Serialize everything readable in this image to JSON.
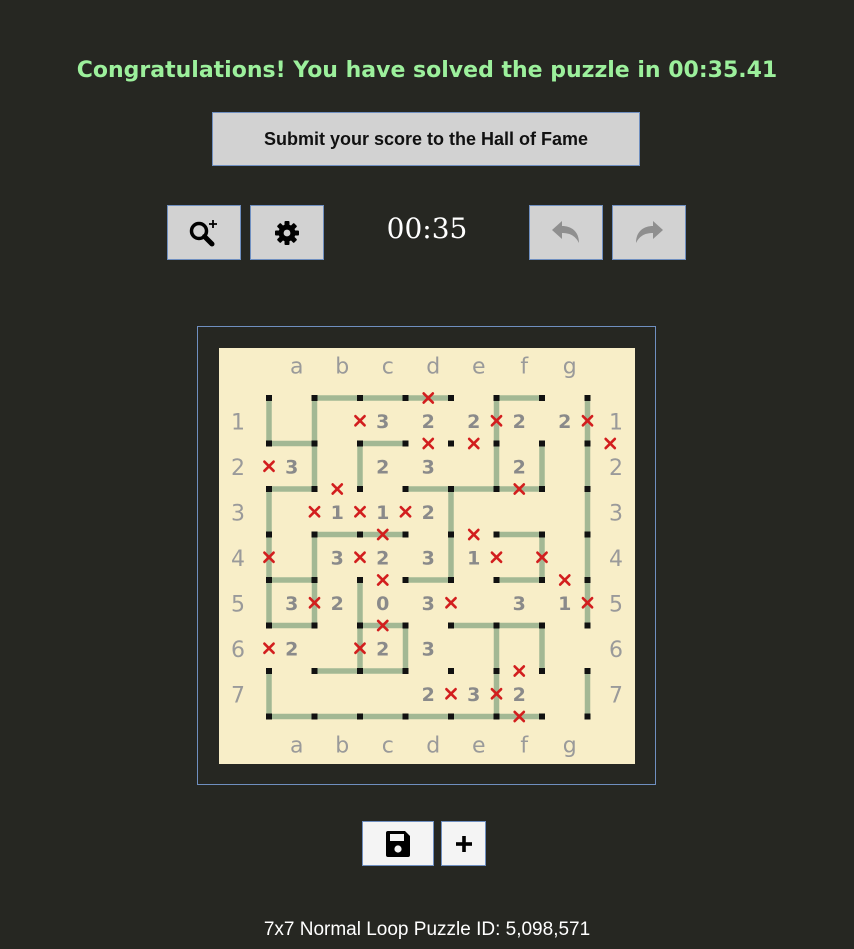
{
  "header": {
    "congrats": "Congratulations! You have solved the puzzle in 00:35.41",
    "submit_label": "Submit your score to the Hall of Fame"
  },
  "toolbar": {
    "timer": "00:35",
    "zoom_icon": "zoom-in-icon",
    "settings_icon": "gear-icon",
    "undo_icon": "undo-icon",
    "redo_icon": "redo-icon"
  },
  "board": {
    "cols": [
      "a",
      "b",
      "c",
      "d",
      "e",
      "f",
      "g"
    ],
    "rows": [
      "1",
      "2",
      "3",
      "4",
      "5",
      "6",
      "7"
    ],
    "clues": [
      [
        "",
        "",
        "3",
        "2",
        "2",
        "2",
        "2"
      ],
      [
        "3",
        "",
        "2",
        "3",
        "",
        "2",
        "",
        ""
      ],
      [
        "",
        "1",
        "1",
        "2",
        "",
        "",
        ""
      ],
      [
        "",
        "3",
        "2",
        "3",
        "1",
        "",
        ""
      ],
      [
        "3",
        "2",
        "0",
        "3",
        "",
        "3",
        "1"
      ],
      [
        "2",
        "",
        "2",
        "3",
        "",
        "",
        ""
      ],
      [
        "",
        "",
        "",
        "2",
        "3",
        "2",
        ""
      ]
    ],
    "h_lines": [
      "011101",
      "101000",
      "100111",
      "011001",
      "100101",
      "101011",
      "011000",
      "111111"
    ],
    "v_lines": [
      "11000101",
      "01100111",
      "10001001",
      "11001011",
      "11100001",
      "00110110",
      "10000101"
    ],
    "h_x": [
      "00010000",
      "00011001",
      "01000100",
      "00101000",
      "00100010",
      "00100000",
      "00000100",
      "00000100"
    ],
    "v_x": [
      "00100101",
      "10000000",
      "01110000",
      "10100110",
      "01001001",
      "10100000",
      "00001100"
    ],
    "colors": {
      "background": "#f8eec8",
      "line": "#a3b894",
      "dot": "#111111",
      "cross": "#d21e1e",
      "clue": "#8a8a8a",
      "label": "#9a9a9a"
    }
  },
  "footer": {
    "save_icon": "save-icon",
    "new_icon": "plus-icon",
    "puzzle_info": "7x7 Normal Loop Puzzle ID: 5,098,571"
  }
}
